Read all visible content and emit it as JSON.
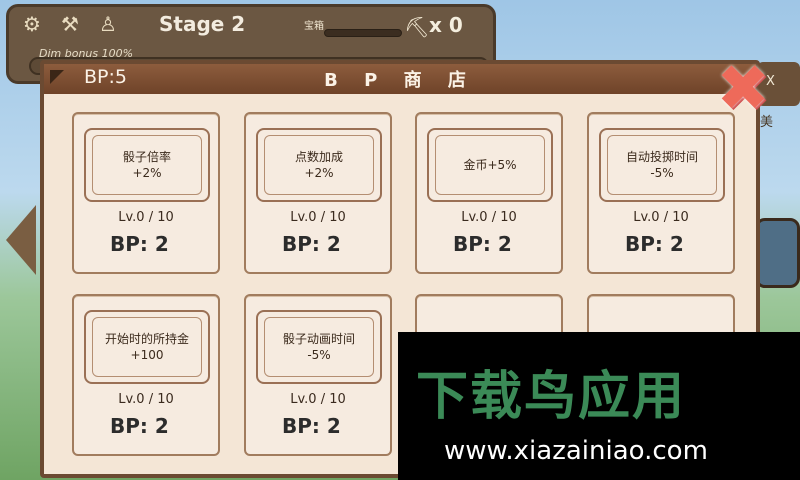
{
  "hud": {
    "icons": [
      "gear-icon",
      "hammer-icon",
      "character-icon"
    ],
    "stage": "Stage 2",
    "chest_label": "宝箱",
    "pickaxe_count": "x 0",
    "dim_bonus": "Dim bonus 100%"
  },
  "side": {
    "right_top_label": "X",
    "right_char": "美"
  },
  "shop": {
    "bp_total": "BP:5",
    "title": "B P 商 店",
    "cards": [
      {
        "name": "骰子倍率",
        "effect": "+2%",
        "level": "Lv.0 / 10",
        "cost": "BP: 2"
      },
      {
        "name": "点数加成",
        "effect": "+2%",
        "level": "Lv.0 / 10",
        "cost": "BP: 2"
      },
      {
        "name": "金币+5%",
        "effect": "",
        "level": "Lv.0 / 10",
        "cost": "BP: 2"
      },
      {
        "name": "自动投掷时间",
        "effect": "-5%",
        "level": "Lv.0 / 10",
        "cost": "BP: 2"
      },
      {
        "name": "开始时的所持金",
        "effect": "+100",
        "level": "Lv.0 / 10",
        "cost": "BP: 2"
      },
      {
        "name": "骰子动画时间",
        "effect": "-5%",
        "level": "Lv.0 / 10",
        "cost": "BP: 2"
      }
    ]
  },
  "watermark": {
    "title": "下载鸟应用",
    "url": "www.xiazainiao.com"
  }
}
